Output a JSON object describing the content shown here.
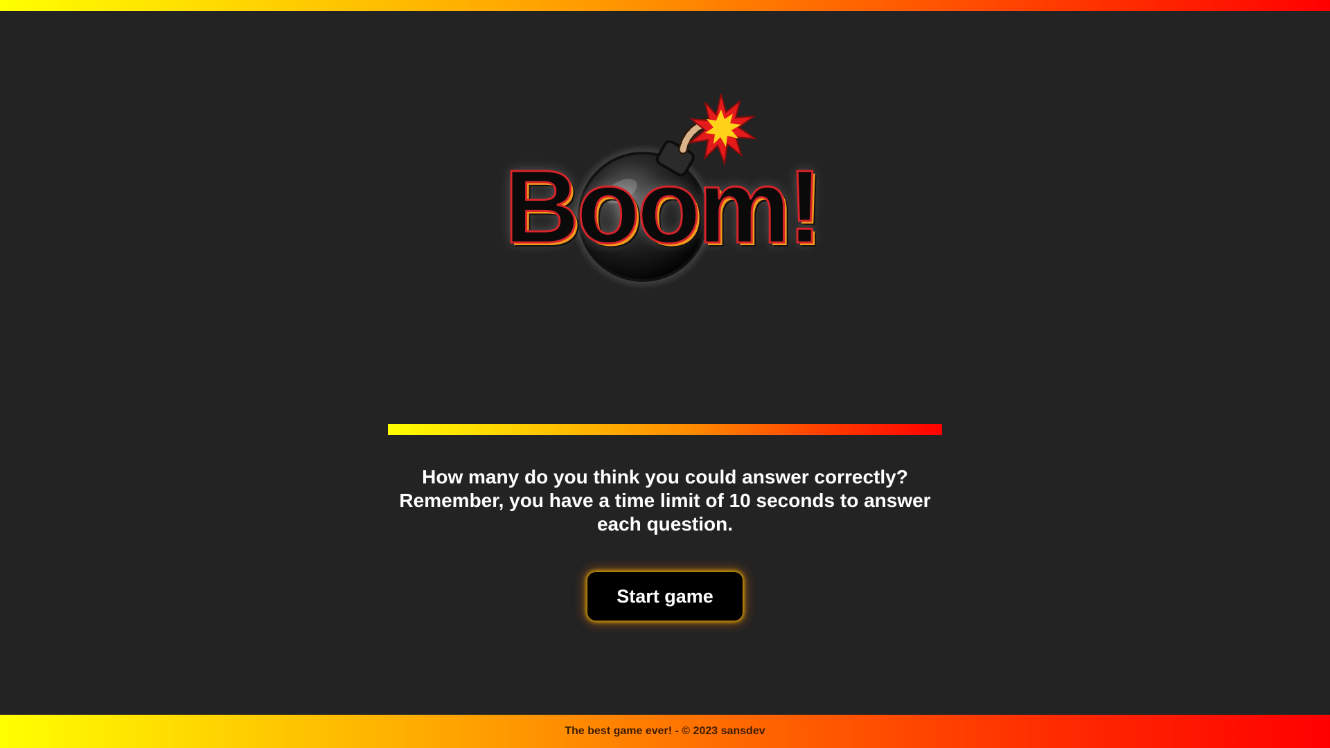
{
  "app": {
    "logo_text": "Boom!",
    "colors": {
      "background": "#232323",
      "gradient_start": "#ffff00",
      "gradient_end": "#ff0000",
      "button_bg": "#000000",
      "text": "#ffffff"
    }
  },
  "main": {
    "question": "How many do you think you could answer correctly? Remember, you have a time limit of 10 seconds to answer each question.",
    "start_button_label": "Start game"
  },
  "footer": {
    "text": "The best game ever! - © 2023 sansdev"
  }
}
